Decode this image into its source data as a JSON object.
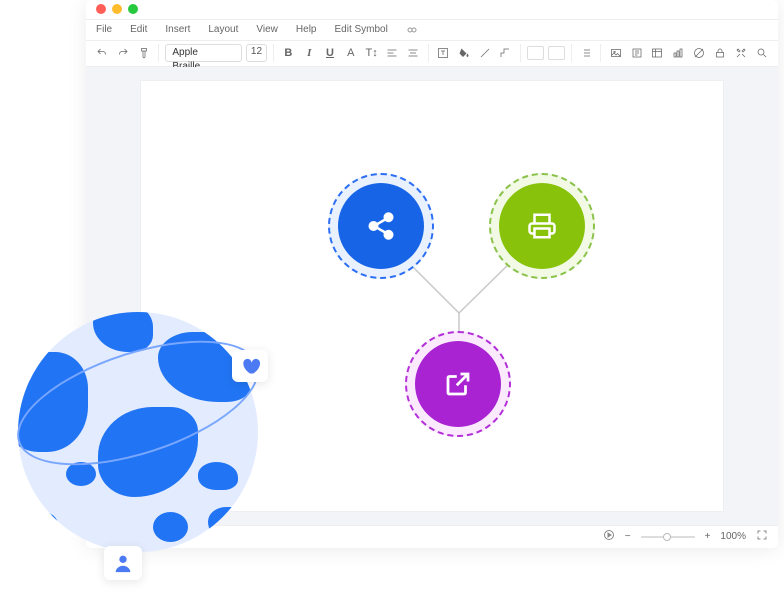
{
  "menubar": [
    "File",
    "Edit",
    "Insert",
    "Layout",
    "View",
    "Help",
    "Edit Symbol"
  ],
  "toolbar": {
    "font_family": "Apple Braille",
    "font_size": "12"
  },
  "status": {
    "zoom_label": "100%"
  },
  "diagram": {
    "nodes": [
      {
        "id": "share",
        "color": "#1765e6"
      },
      {
        "id": "printer",
        "color": "#88c20b"
      },
      {
        "id": "open-external",
        "color": "#a923d3"
      }
    ]
  }
}
